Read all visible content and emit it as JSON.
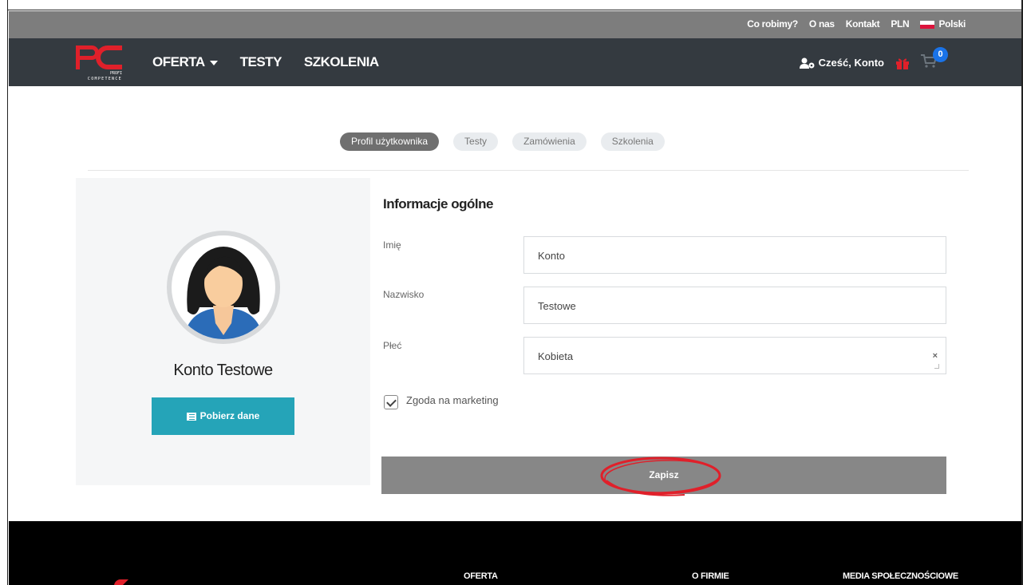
{
  "utility_bar": {
    "links": [
      "Co robimy?",
      "O nas",
      "Kontakt",
      "PLN"
    ],
    "language": "Polski"
  },
  "navbar": {
    "brand_sub1": "PROFI",
    "brand_sub2": "COMPETENCE",
    "items": [
      {
        "label": "OFERTA",
        "has_dropdown": true
      },
      {
        "label": "TESTY",
        "has_dropdown": false
      },
      {
        "label": "SZKOLENIA",
        "has_dropdown": false
      }
    ],
    "greeting": "Cześć, Konto",
    "cart_count": "0"
  },
  "tabs": [
    {
      "label": "Profil użytkownika",
      "active": true
    },
    {
      "label": "Testy",
      "active": false
    },
    {
      "label": "Zamówienia",
      "active": false
    },
    {
      "label": "Szkolenia",
      "active": false
    }
  ],
  "profile": {
    "name": "Konto Testowe",
    "download_label": "Pobierz dane"
  },
  "form": {
    "title": "Informacje ogólne",
    "fields": [
      {
        "label": "Imię",
        "value": "Konto"
      },
      {
        "label": "Nazwisko",
        "value": "Testowe"
      },
      {
        "label": "Płeć",
        "value": "Kobieta"
      }
    ],
    "consent_label": "Zgoda na marketing",
    "consent_checked": true,
    "save_label": "Zapisz"
  },
  "footer": {
    "columns": [
      "OFERTA",
      "O FIRMIE",
      "MEDIA SPOŁECZNOŚCIOWE"
    ]
  },
  "colors": {
    "navbar": "#343a40",
    "utility_bar": "#7d7d7d",
    "accent_red": "#e0202a",
    "teal_button": "#25a4b8",
    "save_button": "#878787",
    "badge_blue": "#1a73e8"
  }
}
